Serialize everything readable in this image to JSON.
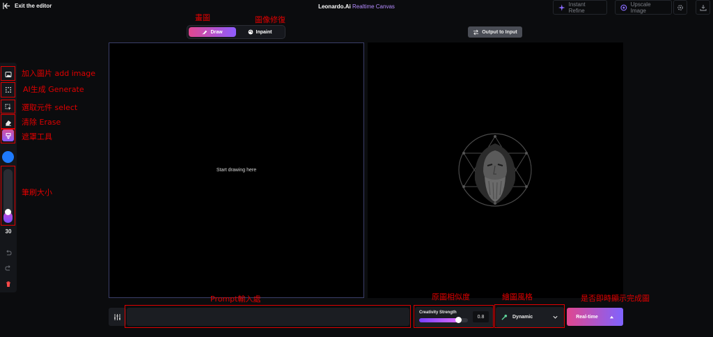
{
  "topbar": {
    "exit_label": "Exit the editor",
    "app_name": "Leonardo.Ai",
    "app_subtitle": "Realtime Canvas",
    "instant_refine_label": "Instant Refine",
    "upscale_label": "Upscale Image"
  },
  "modes": {
    "draw_label": "Draw",
    "inpaint_label": "Inpaint"
  },
  "output_to_input_label": "Output to Input",
  "canvas": {
    "placeholder": "Start drawing here"
  },
  "toolbar": {
    "brush_color": "#1e7bff",
    "brush_size": "30",
    "brush_level_percent": 20
  },
  "bottom": {
    "prompt_value": "",
    "creativity_label": "Creativity Strength",
    "creativity_value": "0.8",
    "creativity_fraction": 0.8,
    "style_value": "Dynamic",
    "realtime_label": "Real-time"
  },
  "annotations": {
    "draw": "畫圖",
    "inpaint": "圖像修復",
    "add_image": "加入圖片 add image",
    "generate": "AI生成 Generate",
    "select": "選取元件 select",
    "erase": "清除 Erase",
    "mask": "遮罩工具",
    "brush_size": "筆刷大小",
    "prompt": "Prompt輸入處",
    "similarity": "原圖相似度",
    "style": "繪圖風格",
    "realtime": "是否即時顯示完成圖"
  },
  "colors": {
    "accent_pink": "#e0478f",
    "accent_purple": "#8e5cff",
    "annotation_red": "#e00000"
  },
  "icons": [
    "arrow-left-icon",
    "sparkle-icon",
    "upscale-icon",
    "gear-icon",
    "download-icon",
    "brush-icon",
    "palette-icon",
    "swap-icon",
    "image-icon",
    "grid-icon",
    "select-icon",
    "eraser-icon",
    "mask-icon",
    "undo-icon",
    "redo-icon",
    "trash-icon",
    "sliders-icon",
    "style-icon",
    "chevron-down-icon",
    "caret-up-icon"
  ]
}
